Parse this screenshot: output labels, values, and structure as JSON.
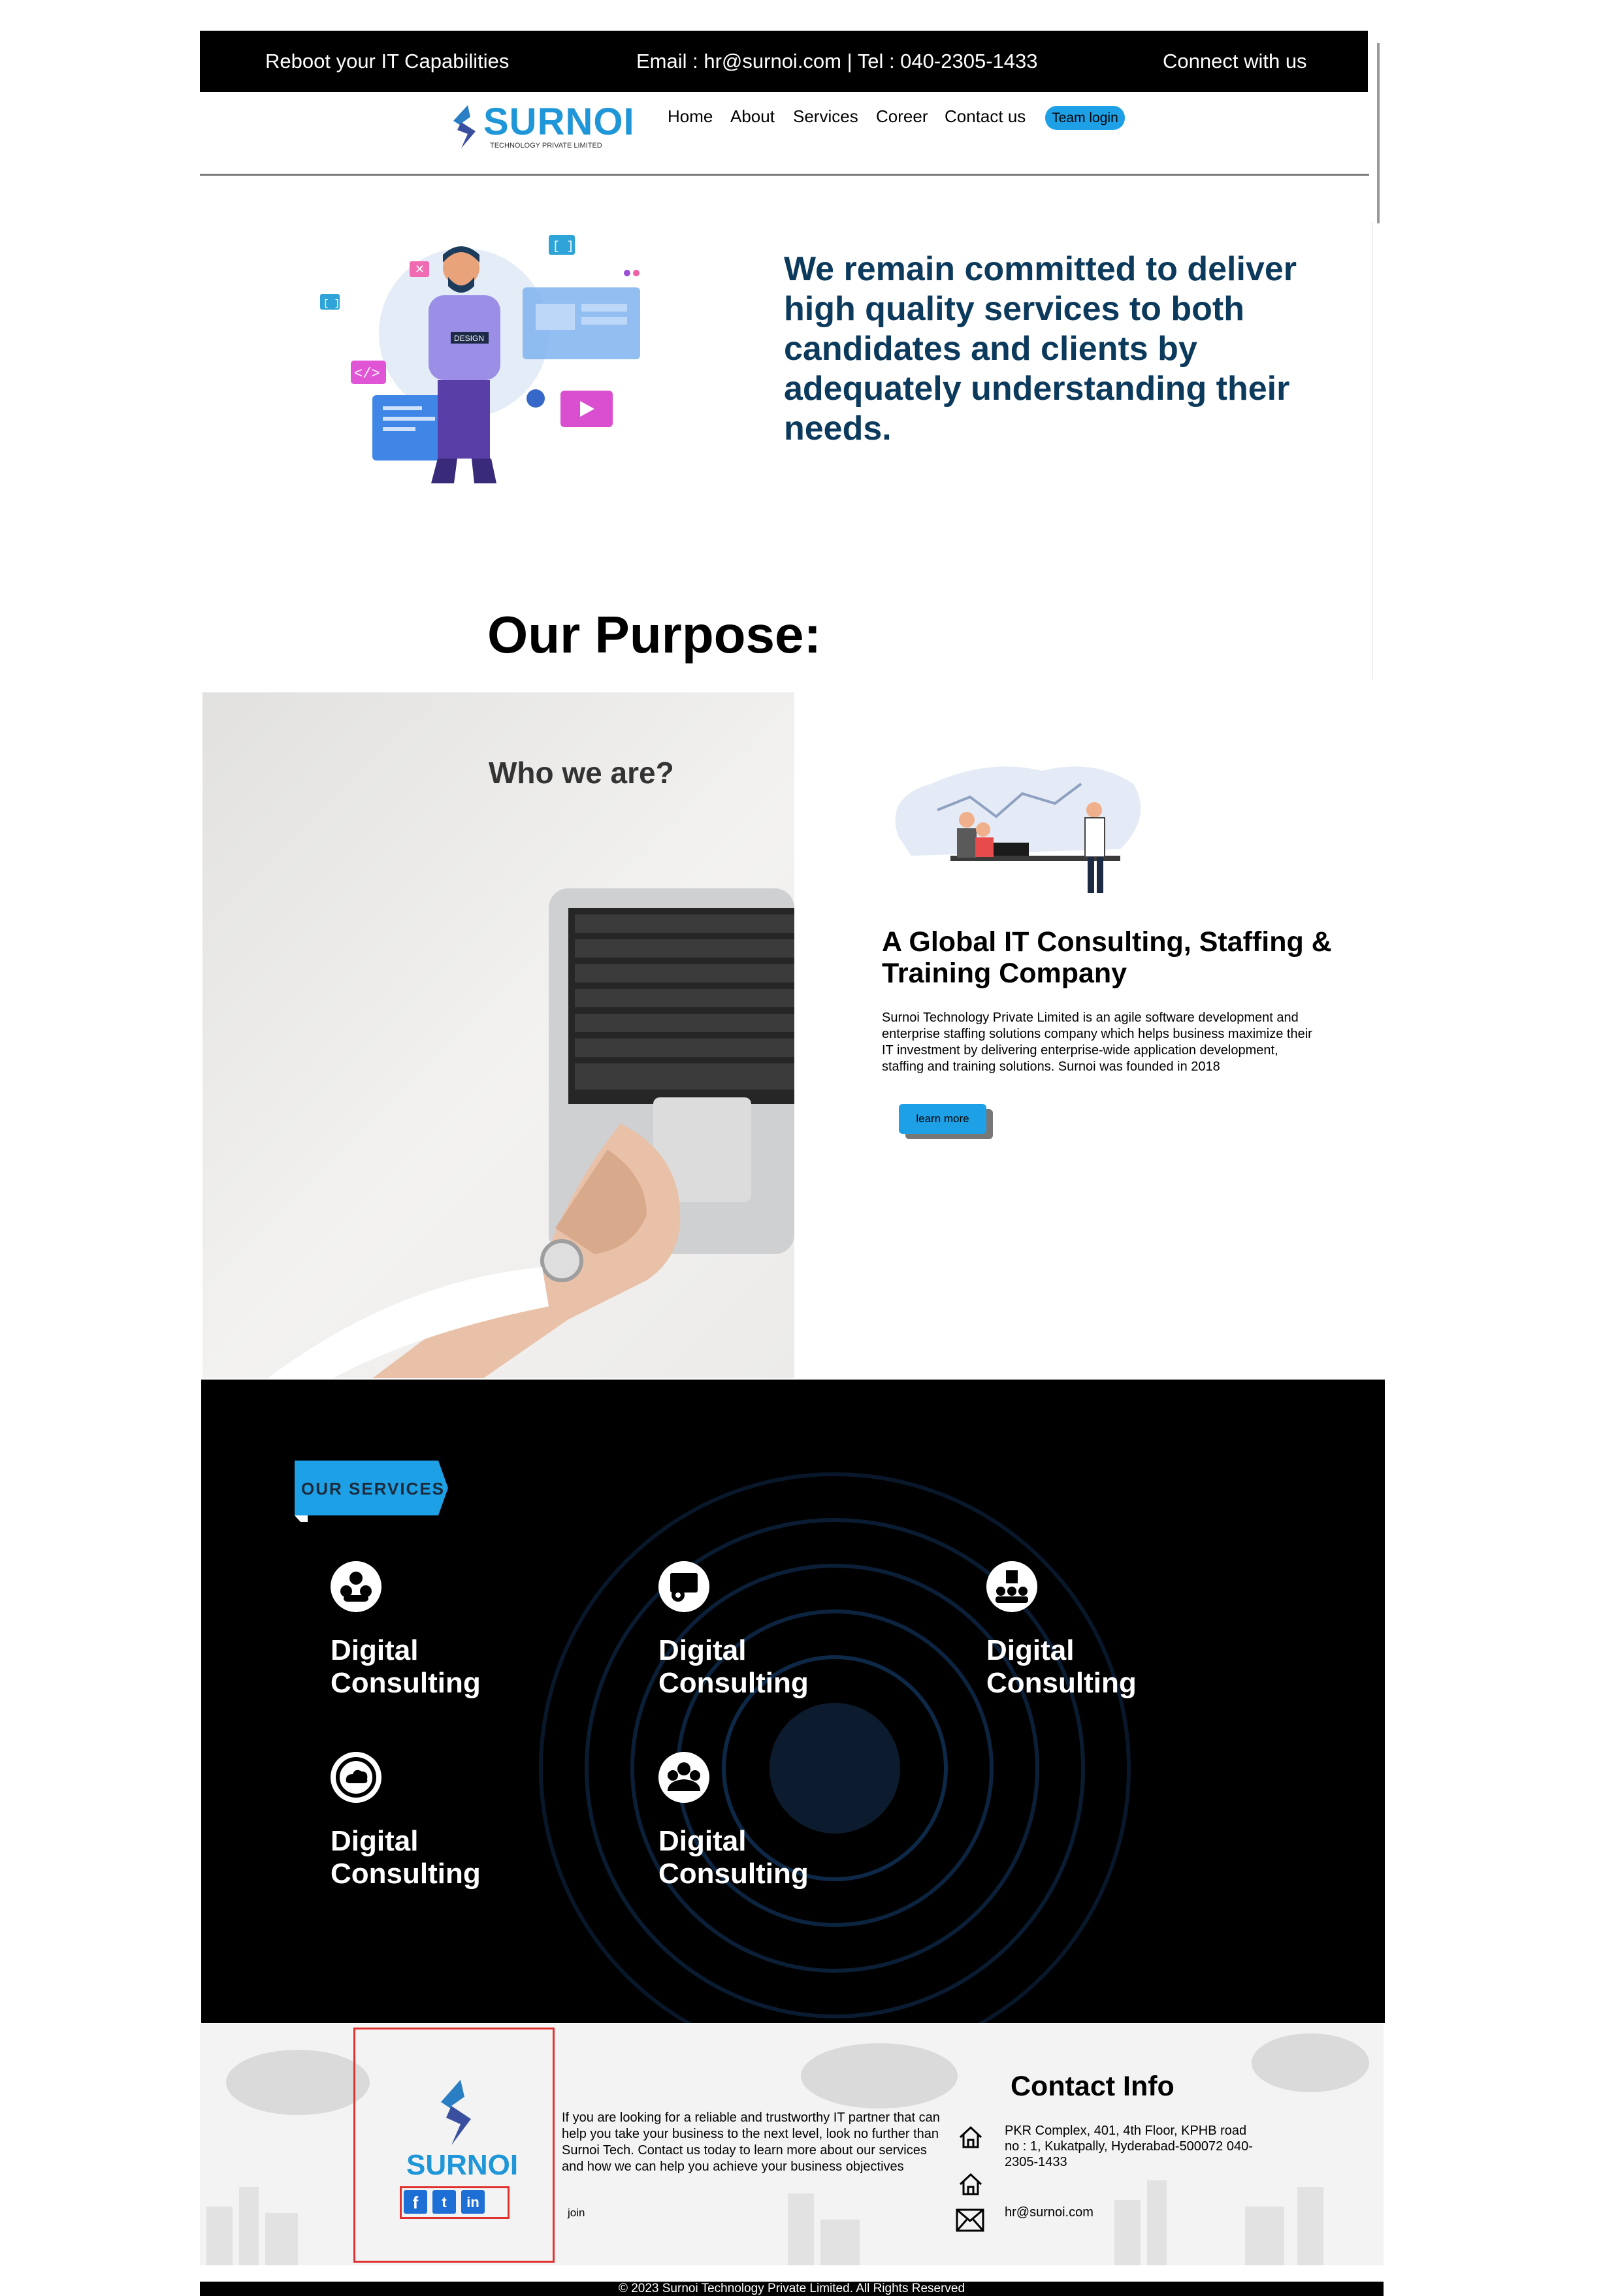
{
  "topbar": {
    "tagline": "Reboot your IT Capabilities",
    "contact": "Email : hr@surnoi.com | Tel : 040-2305-1433",
    "connect": "Connect with us"
  },
  "brand": {
    "name": "SURNOI",
    "subtitle": "TECHNOLOGY PRIVATE LIMITED",
    "color": "#1e96d8"
  },
  "nav": {
    "items": [
      "Home",
      "About",
      "Services",
      "Coreer",
      "Contact us"
    ],
    "team_login": "Team login"
  },
  "hero": {
    "statement": "We remain committed to deliver high quality services to both candidates and clients by adequately understanding their needs.",
    "illustration_badge": "DESIGN"
  },
  "purpose": {
    "title": "Our Purpose:",
    "photo_caption": "Who we are?"
  },
  "about": {
    "title": "A Global IT Consulting, Staffing & Training Company",
    "description": "Surnoi Technology Private Limited is an agile software development and enterprise staffing solutions company which helps business maximize their IT investment by delivering enterprise-wide application development, staffing and training solutions. Surnoi was founded in 2018",
    "button": "learn more"
  },
  "services": {
    "ribbon": "OUR SERVICES",
    "items": [
      {
        "icon": "group-icon",
        "line1": "Digital",
        "line2": "Consulting"
      },
      {
        "icon": "settings-board-icon",
        "line1": "Digital",
        "line2": "Consulting"
      },
      {
        "icon": "org-chart-icon",
        "line1": "Digital",
        "line2": "Consulting"
      },
      {
        "icon": "cloud-icon",
        "line1": "Digital",
        "line2": "Consulting"
      },
      {
        "icon": "team-icon",
        "line1": "Digital",
        "line2": "Consulting"
      }
    ]
  },
  "footer": {
    "brand": "SURNOI",
    "description": "If you are looking for a reliable and trustworthy IT partner that can help you take your business to the next level, look no further than Surnoi Tech. Contact us today to learn more about our services and how we can help you achieve your business objectives",
    "join": "join",
    "social": [
      "f",
      "t",
      "in"
    ],
    "contact_title": "Contact Info",
    "address": "PKR Complex, 401, 4th Floor, KPHB road no : 1, Kukatpally, Hyderabad-500072 040-2305-1433",
    "email": "hr@surnoi.com"
  },
  "copyright": "© 2023 Surnoi Technology Private Limited. All Rights Reserved"
}
